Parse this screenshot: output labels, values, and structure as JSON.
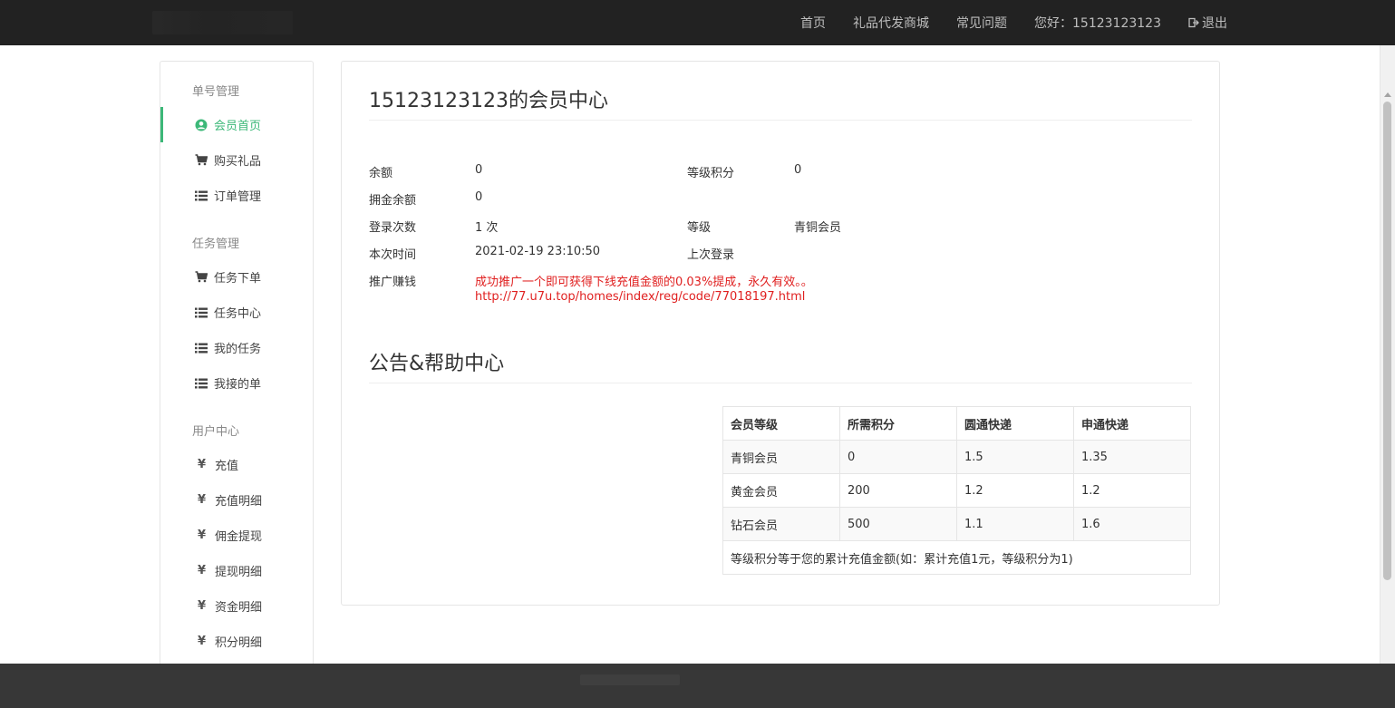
{
  "topnav": {
    "home": "首页",
    "gift_mall": "礼品代发商城",
    "faq": "常见问题",
    "greeting": "您好：15123123123",
    "logout": "退出"
  },
  "sidebar": {
    "groups": [
      "单号管理",
      "任务管理",
      "用户中心"
    ],
    "items": [
      {
        "label": "会员首页",
        "icon": "user-circle-icon",
        "active": true
      },
      {
        "label": "购买礼品",
        "icon": "cart-icon"
      },
      {
        "label": "订单管理",
        "icon": "list-icon"
      },
      {
        "label": "任务下单",
        "icon": "cart-icon"
      },
      {
        "label": "任务中心",
        "icon": "list-icon"
      },
      {
        "label": "我的任务",
        "icon": "list-icon"
      },
      {
        "label": "我接的单",
        "icon": "list-icon"
      },
      {
        "label": "充值",
        "icon": "yen-icon"
      },
      {
        "label": "充值明细",
        "icon": "yen-icon"
      },
      {
        "label": "佣金提现",
        "icon": "yen-icon"
      },
      {
        "label": "提现明细",
        "icon": "yen-icon"
      },
      {
        "label": "资金明细",
        "icon": "yen-icon"
      },
      {
        "label": "积分明细",
        "icon": "yen-icon"
      }
    ],
    "yen_glyph": "¥"
  },
  "main": {
    "title": "15123123123的会员中心",
    "info": {
      "balance_label": "余额",
      "balance_value": "0",
      "level_points_label": "等级积分",
      "level_points_value": "0",
      "commission_label": "拥金余额",
      "commission_value": "0",
      "login_count_label": "登录次数",
      "login_count_value": "1 次",
      "level_label": "等级",
      "level_value": "青铜会员",
      "this_time_label": "本次时间",
      "this_time_value": "2021-02-19 23:10:50",
      "last_login_label": "上次登录",
      "last_login_value": "",
      "promo_label": "推广赚钱",
      "promo_text": "成功推广一个即可获得下线充值金额的0.03%提成，永久有效。。",
      "promo_link": "http://77.u7u.top/homes/index/reg/code/77018197.html"
    },
    "notice_title": "公告&帮助中心",
    "table": {
      "headers": [
        "会员等级",
        "所需积分",
        "圆通快递",
        "申通快递"
      ],
      "rows": [
        [
          "青铜会员",
          "0",
          "1.5",
          "1.35"
        ],
        [
          "黄金会员",
          "200",
          "1.2",
          "1.2"
        ],
        [
          "钻石会员",
          "500",
          "1.1",
          "1.6"
        ]
      ],
      "note": "等级积分等于您的累计充值金额(如：累计充值1元，等级积分为1)"
    }
  },
  "colors": {
    "topbar": "#222222",
    "accent": "#3cb878",
    "promo": "#e02020",
    "footer": "#373737"
  }
}
